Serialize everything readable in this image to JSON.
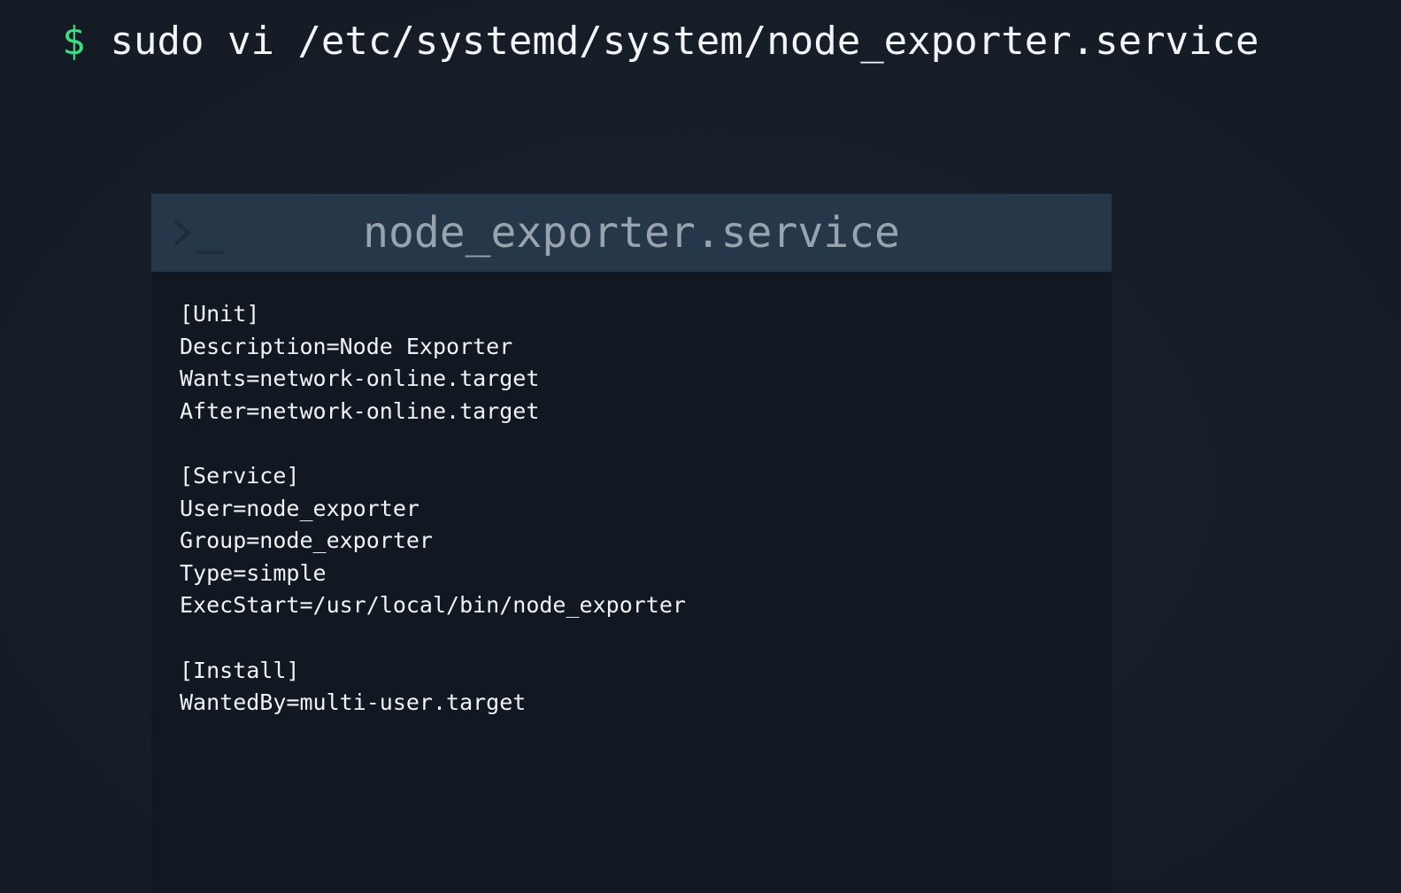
{
  "command": {
    "prompt": "$",
    "text": "sudo vi /etc/systemd/system/node_exporter.service"
  },
  "panel": {
    "icon": "terminal-icon",
    "title": "node_exporter.service"
  },
  "file_lines": [
    "[Unit]",
    "Description=Node Exporter",
    "Wants=network-online.target",
    "After=network-online.target",
    "",
    "[Service]",
    "User=node_exporter",
    "Group=node_exporter",
    "Type=simple",
    "ExecStart=/usr/local/bin/node_exporter",
    "",
    "[Install]",
    "WantedBy=multi-user.target"
  ],
  "colors": {
    "background": "#18202b",
    "prompt": "#3ddc84",
    "panel_header": "#27374a",
    "panel_body": "#111821"
  }
}
